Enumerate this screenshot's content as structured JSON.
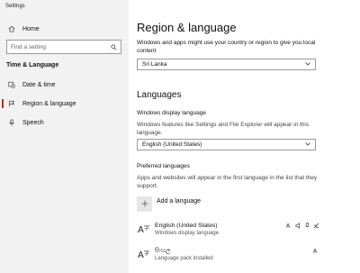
{
  "window": {
    "title": "Settings"
  },
  "sidebar": {
    "home_label": "Home",
    "search_placeholder": "Find a setting",
    "section_heading": "Time & Language",
    "items": [
      {
        "label": "Date & time",
        "icon": "calendar-clock-icon",
        "active": false
      },
      {
        "label": "Region & language",
        "icon": "region-icon",
        "active": true
      },
      {
        "label": "Speech",
        "icon": "microphone-icon",
        "active": false
      }
    ]
  },
  "main": {
    "page_title": "Region & language",
    "region_description": "Windows and apps might use your country or region to give you local content",
    "country_selected": "Sri Lanka",
    "languages_heading": "Languages",
    "display_language_label": "Windows display language",
    "display_language_description": "Windows features like Settings and File Explorer will appear in this language.",
    "display_language_selected": "English (United States)",
    "preferred_heading": "Preferred languages",
    "preferred_description": "Apps and websites will appear in the first language in the list that they support.",
    "add_language_label": "Add a language",
    "languages": [
      {
        "name": "English (United States)",
        "subtitle": "Windows display language"
      },
      {
        "name": "සිංහල",
        "subtitle": "Language pack installed"
      }
    ]
  },
  "colors": {
    "sidebar_bg": "#f2f2f2",
    "active_indicator": "#c42b1c",
    "content_bg": "#ffffff"
  }
}
